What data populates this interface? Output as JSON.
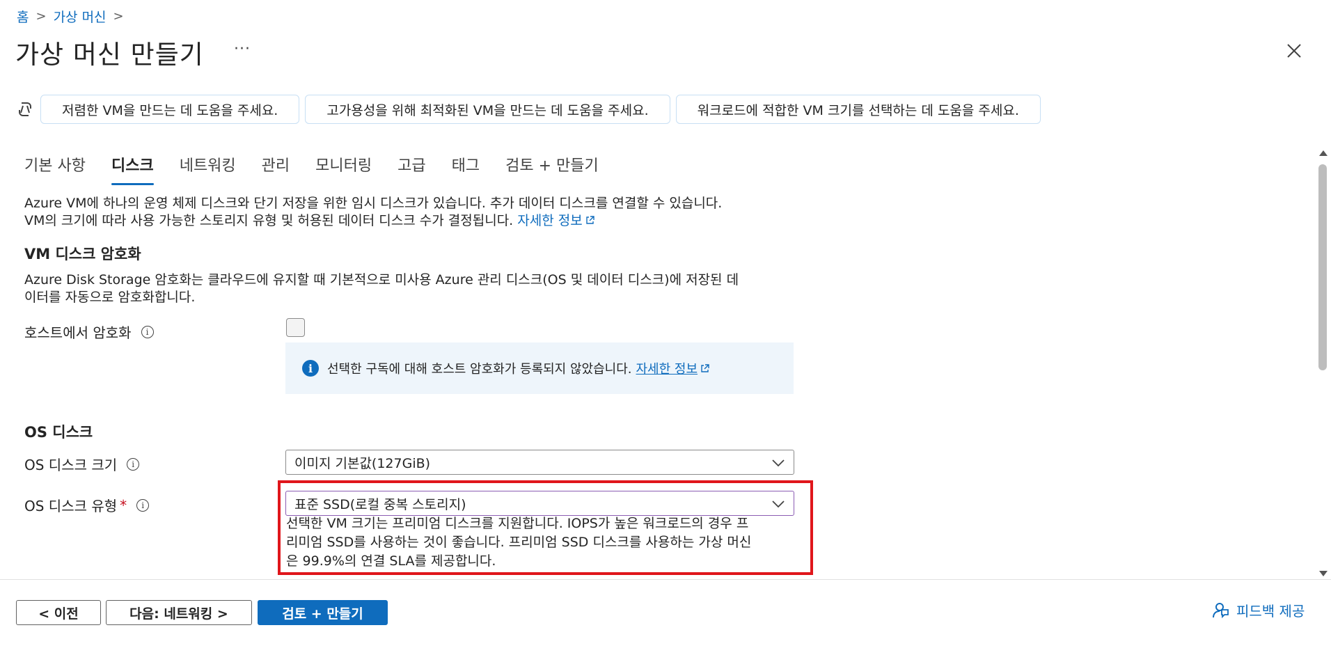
{
  "breadcrumb": {
    "home": "홈",
    "parent": "가상 머신",
    "sep": ">"
  },
  "header": {
    "title": "가상 머신 만들기",
    "more": "···"
  },
  "copilot": {
    "suggestions": [
      "저렴한 VM을 만드는 데 도움을 주세요.",
      "고가용성을 위해 최적화된 VM을 만드는 데 도움을 주세요.",
      "워크로드에 적합한 VM 크기를 선택하는 데 도움을 주세요."
    ]
  },
  "tabs": [
    "기본 사항",
    "디스크",
    "네트워킹",
    "관리",
    "모니터링",
    "고급",
    "태그",
    "검토 + 만들기"
  ],
  "active_tab": "디스크",
  "intro": {
    "line1": "Azure VM에 하나의 운영 체제 디스크와 단기 저장을 위한 임시 디스크가 있습니다. 추가 데이터 디스크를 연결할 수 있습니다.",
    "line2": "VM의 크기에 따라 사용 가능한 스토리지 유형 및 허용된 데이터 디스크 수가 결정됩니다.",
    "learn_more": "자세한 정보"
  },
  "encryption": {
    "heading": "VM 디스크 암호화",
    "desc_line1": "Azure Disk Storage 암호화는 클라우드에 유지할 때 기본적으로 미사용 Azure 관리 디스크(OS 및 데이터 디스크)에 저장된 데",
    "desc_line2": "이터를 자동으로 암호화합니다.",
    "host_label": "호스트에서 암호화",
    "host_checked": false,
    "info_text": "선택한 구독에 대해 호스트 암호화가 등록되지 않았습니다.",
    "info_link": "자세한 정보"
  },
  "os_disk": {
    "heading": "OS 디스크",
    "size_label": "OS 디스크 크기",
    "size_value": "이미지 기본값(127GiB)",
    "type_label": "OS 디스크 유형",
    "required_mark": "*",
    "type_value": "표준 SSD(로컬 중복 스토리지)",
    "hint_line1": "선택한 VM 크기는 프리미엄 디스크를 지원합니다. IOPS가 높은 워크로드의 경우 프",
    "hint_line2": "리미엄 SSD를 사용하는 것이 좋습니다. 프리미엄 SSD 디스크를 사용하는 가상 머신",
    "hint_line3": "은 99.9%의 연결 SLA를 제공합니다."
  },
  "footer": {
    "prev": "< 이전",
    "next": "다음: 네트워킹 >",
    "review": "검토 + 만들기",
    "feedback": "피드백 제공"
  },
  "colors": {
    "accent": "#0f6cbd",
    "highlight": "#e0161b",
    "required": "#c50f1f",
    "info_bg": "#eef5fb"
  }
}
